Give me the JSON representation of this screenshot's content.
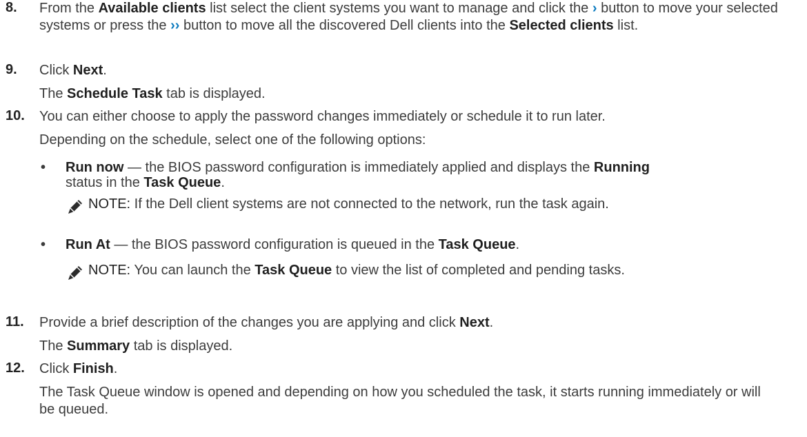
{
  "steps": {
    "s8": {
      "number": "8.",
      "t1": "From the ",
      "b1": "Available clients",
      "t2": " list select the client systems you want to manage and click the ",
      "t3": " button to move your selected systems or press the ",
      "t4": " button to move all the discovered Dell clients into the ",
      "b2": "Selected clients",
      "t5": " list."
    },
    "s9": {
      "number": "9.",
      "t1": "Click ",
      "b1": "Next",
      "t2": ".",
      "sub_t1": "The ",
      "sub_b1": "Schedule Task",
      "sub_t2": " tab is displayed."
    },
    "s10": {
      "number": "10.",
      "line1": "You can either choose to apply the password changes immediately or schedule it to run later.",
      "line2": "Depending on the schedule, select one of the following options:",
      "bullets": [
        {
          "bold": "Run now",
          "t1": " — the BIOS password configuration is immediately applied and displays the ",
          "b2": "Running",
          "t2": " status in the ",
          "b3": "Task Queue",
          "t3": ".",
          "note_label": "NOTE:",
          "note_t1": " If the Dell client systems are not connected to the network, run the task again."
        },
        {
          "bold": "Run At",
          "t1": " — the BIOS password configuration is queued in the ",
          "b2": "Task Queue",
          "t2": ".",
          "note_label": "NOTE:",
          "note_t1": " You can launch the ",
          "note_b1": "Task Queue",
          "note_t2": " to view the list of completed and pending tasks."
        }
      ]
    },
    "s11": {
      "number": "11.",
      "t1": "Provide a brief description of the changes you are applying and click ",
      "b1": "Next",
      "t2": ".",
      "sub_t1": "The ",
      "sub_b1": "Summary",
      "sub_t2": " tab is displayed."
    },
    "s12": {
      "number": "12.",
      "t1": "Click ",
      "b1": "Finish",
      "t2": ".",
      "sub": "The Task Queue window is opened and depending on how you scheduled the task, it starts running immediately or will be queued."
    }
  },
  "glyphs": {
    "single_chevron": "›",
    "double_chevron": "››"
  },
  "colors": {
    "chevron": "#0a7abf",
    "text": "#3c3c3c"
  },
  "icons": {
    "note": "note-pencil-icon"
  }
}
